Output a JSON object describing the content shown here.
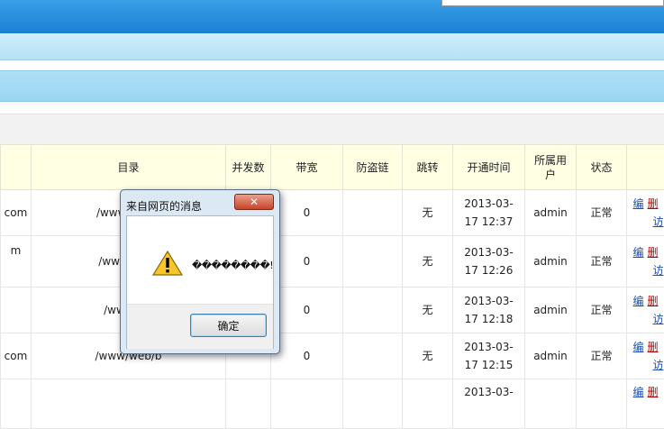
{
  "table": {
    "headers": [
      "",
      "目录",
      "并发数",
      "带宽",
      "防盗链",
      "跳转",
      "开通时间",
      "所属用户",
      "状态",
      ""
    ],
    "rows": [
      {
        "domain": "com",
        "dir": "/www/web/t",
        "bandwidth": "0",
        "redirect": "无",
        "date": "2013-03-",
        "time": "17 12:37",
        "user": "admin",
        "status": "正常"
      },
      {
        "domain": "m",
        "dir": "/www/web/",
        "bandwidth": "0",
        "redirect": "无",
        "date": "2013-03-",
        "time": "17 12:26",
        "user": "admin",
        "status": "正常"
      },
      {
        "domain": "",
        "dir": "/www/we",
        "bandwidth": "0",
        "redirect": "无",
        "date": "2013-03-",
        "time": "17 12:18",
        "user": "admin",
        "status": "正常"
      },
      {
        "domain": "com",
        "dir": "/www/web/b",
        "bandwidth": "0",
        "redirect": "无",
        "date": "2013-03-",
        "time": "17 12:15",
        "user": "admin",
        "status": "正常"
      },
      {
        "domain": "",
        "dir": "",
        "bandwidth": "",
        "redirect": "",
        "date": "2013-03-",
        "time": "",
        "user": "",
        "status": ""
      }
    ],
    "ops": {
      "edit": "编",
      "delete": "删",
      "third": "访"
    }
  },
  "dialog": {
    "title": "来自网页的消息",
    "close": "✕",
    "message": "��������!",
    "ok_label": "确定"
  },
  "colors": {
    "accent_blue": "#1a7fd3",
    "header_yellow": "#ffffe4",
    "delete_red": "#c00000"
  }
}
